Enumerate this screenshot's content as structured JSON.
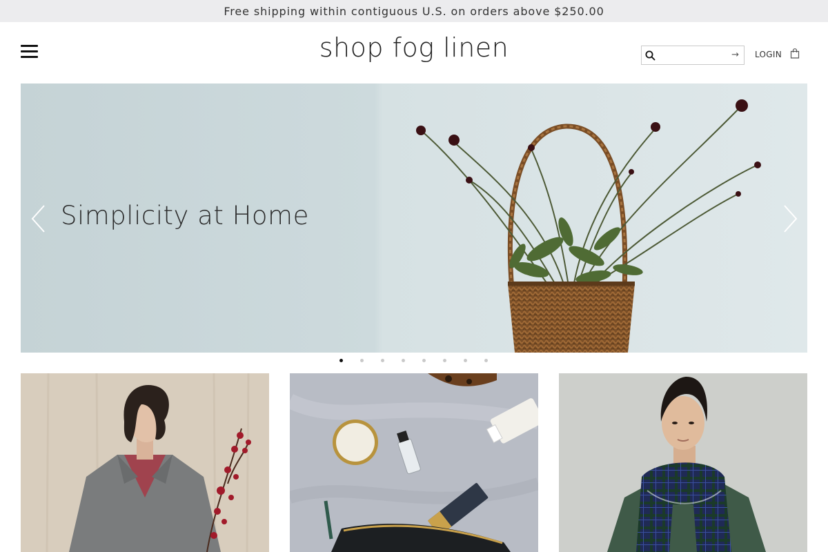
{
  "announcement": {
    "text": "Free shipping within contiguous U.S. on orders above $250.00"
  },
  "header": {
    "logo": "shop fog linen",
    "search": {
      "value": "",
      "placeholder": "",
      "submit_glyph": "→"
    },
    "login_label": "LOGIN",
    "icons": {
      "menu": "hamburger-menu-icon",
      "search": "search-icon",
      "bag": "shopping-bag-icon"
    }
  },
  "hero": {
    "caption": "Simplicity at Home",
    "slide_count": 8,
    "active_slide": 1,
    "colors": {
      "wall": "#cbd9dc",
      "basket": "#8a5a2e"
    }
  },
  "tiles": [
    {
      "name": "tile-grey-coat-model"
    },
    {
      "name": "tile-accessories-flatlay"
    },
    {
      "name": "tile-plaid-scarf-model"
    }
  ]
}
